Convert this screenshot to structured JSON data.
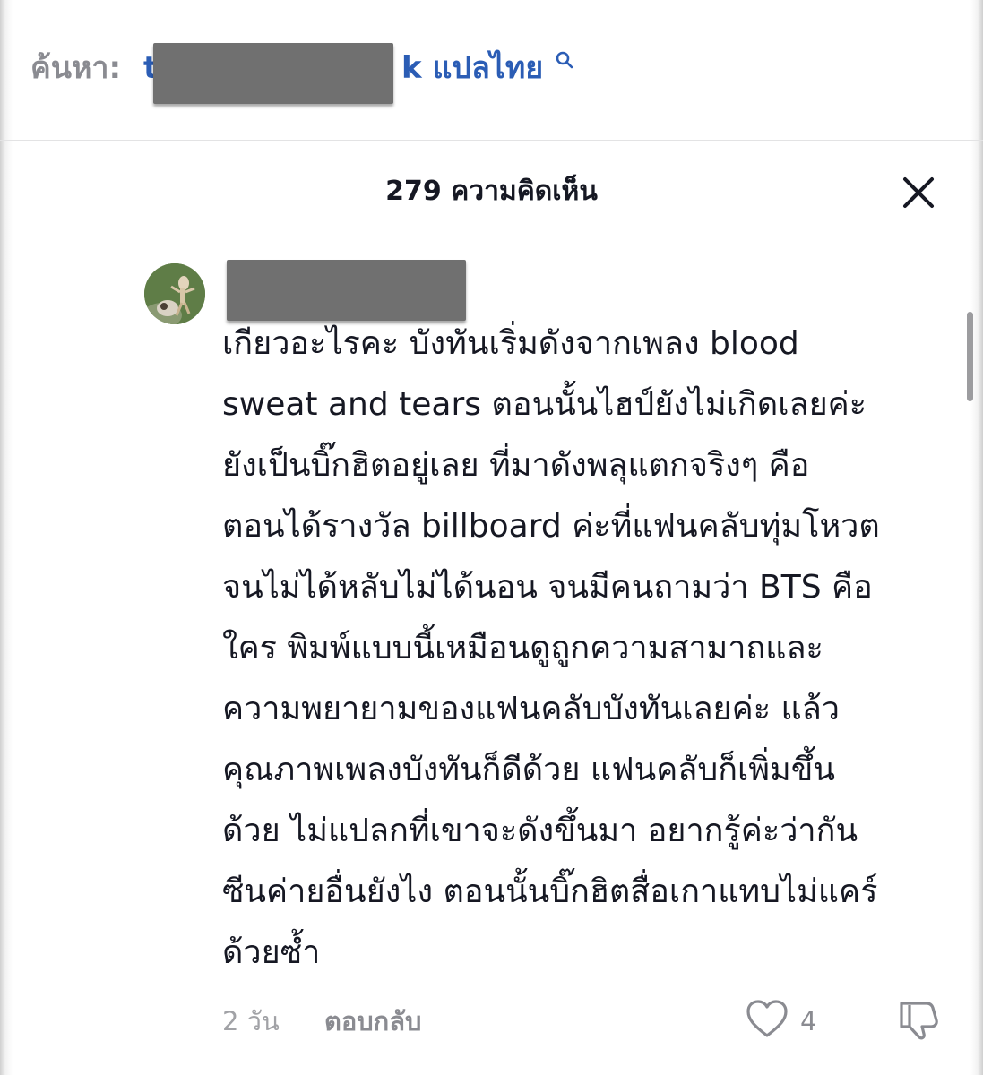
{
  "search": {
    "prefix_label": "ค้นหา:",
    "query_visible_start": "t",
    "query_visible_end": "k แปลไทย",
    "icon": "search-icon"
  },
  "comments_panel": {
    "title": "279 ความคิดเห็น",
    "close_icon": "close-icon"
  },
  "comment": {
    "text_lines": [
      "เกียวอะไรคะ บังทันเริ่มดังจากเพลง blood",
      "sweat and tears ตอนนั้นไฮป์ยังไม่เกิดเลยค่ะ",
      "ยังเป็นบิ๊กฮิตอยู่เลย ที่มาดังพลุแตกจริงๆ คือ",
      "ตอนได้รางวัล billboard ค่ะที่แฟนคลับทุ่มโหวต",
      "จนไม่ได้หลับไม่ได้นอน จนมีคนถามว่า BTS คือ",
      "ใคร พิมพ์แบบนี้เหมือนดูถูกความสามาถและ",
      "ความพยายามของแฟนคลับบังทันเลยค่ะ แล้ว",
      "คุณภาพเพลงบังทันก็ดีด้วย แฟนคลับก็เพิ่มขึ้น",
      "ด้วย ไม่แปลกที่เขาจะดังขึ้นมา อยากรู้ค่ะว่ากัน",
      "ซีนค่ายอื่นยังไง ตอนนั้นบิ๊กฮิตสื่อเกาแทบไม่แคร์",
      "ด้วยซ้ำ"
    ],
    "timestamp": "2 วัน",
    "reply_label": "ตอบกลับ",
    "like_count": "4",
    "like_icon": "heart-icon",
    "dislike_icon": "thumbs-down-icon"
  },
  "colors": {
    "query_blue": "#2b5db5",
    "muted_gray": "#8a8b91",
    "text_dark": "#161823",
    "redaction_gray": "#707070"
  }
}
